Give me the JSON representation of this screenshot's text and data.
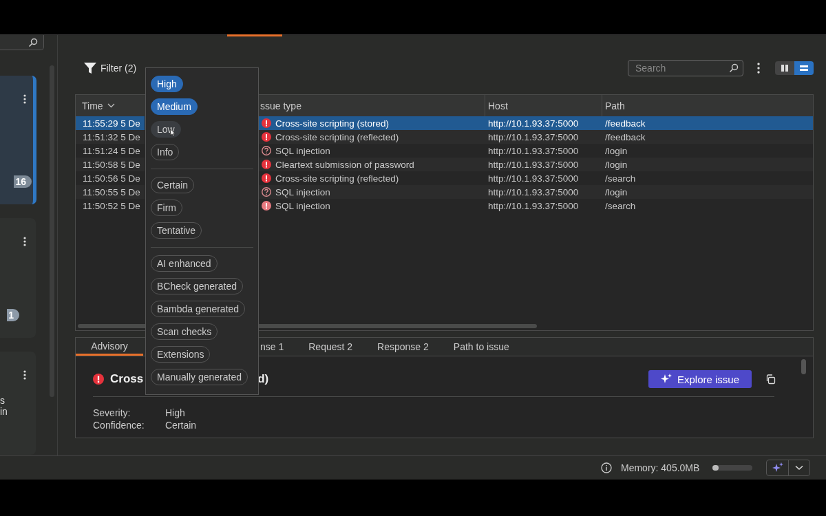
{
  "sidebar": {
    "cards": [
      {
        "selected": true,
        "badge": "16"
      },
      {
        "selected": false,
        "badge": "1"
      },
      {
        "selected": false,
        "text": "s in"
      }
    ]
  },
  "filter": {
    "label": "Filter (2)"
  },
  "filter_menu": {
    "groups": [
      [
        {
          "label": "High",
          "selected": true,
          "hovered": false
        },
        {
          "label": "Medium",
          "selected": true,
          "hovered": false
        },
        {
          "label": "Low",
          "selected": false,
          "hovered": true
        },
        {
          "label": "Info",
          "selected": false,
          "hovered": false
        }
      ],
      [
        {
          "label": "Certain",
          "selected": false,
          "hovered": false
        },
        {
          "label": "Firm",
          "selected": false,
          "hovered": false
        },
        {
          "label": "Tentative",
          "selected": false,
          "hovered": false
        }
      ],
      [
        {
          "label": "AI enhanced",
          "selected": false,
          "hovered": false
        },
        {
          "label": "BCheck generated",
          "selected": false,
          "hovered": false
        },
        {
          "label": "Bambda generated",
          "selected": false,
          "hovered": false
        },
        {
          "label": "Scan checks",
          "selected": false,
          "hovered": false
        },
        {
          "label": "Extensions",
          "selected": false,
          "hovered": false
        },
        {
          "label": "Manually generated",
          "selected": false,
          "hovered": false
        }
      ]
    ]
  },
  "search": {
    "placeholder": "Search"
  },
  "view_toggle": [
    {
      "kind": "columns",
      "selected": false
    },
    {
      "kind": "rows",
      "selected": true
    }
  ],
  "table": {
    "columns": [
      "Time",
      "ssue type",
      "Host",
      "Path"
    ],
    "rows": [
      {
        "time": "11:55:29 5 De",
        "kind": "alert",
        "issue": "Cross-site scripting (stored)",
        "host": "http://10.1.93.37:5000",
        "path": "/feedback",
        "selected": true
      },
      {
        "time": "11:51:32 5 De",
        "kind": "alert",
        "issue": "Cross-site scripting (reflected)",
        "host": "http://10.1.93.37:5000",
        "path": "/feedback",
        "selected": false
      },
      {
        "time": "11:51:24 5 De",
        "kind": "question",
        "issue": "SQL injection",
        "host": "http://10.1.93.37:5000",
        "path": "/login",
        "selected": false
      },
      {
        "time": "11:50:58 5 De",
        "kind": "alert",
        "issue": "Cleartext submission of password",
        "host": "http://10.1.93.37:5000",
        "path": "/login",
        "selected": false
      },
      {
        "time": "11:50:56 5 De",
        "kind": "alert",
        "issue": "Cross-site scripting (reflected)",
        "host": "http://10.1.93.37:5000",
        "path": "/search",
        "selected": false
      },
      {
        "time": "11:50:55 5 De",
        "kind": "question",
        "issue": "SQL injection",
        "host": "http://10.1.93.37:5000",
        "path": "/login",
        "selected": false
      },
      {
        "time": "11:50:52 5 De",
        "kind": "faded",
        "issue": "SQL injection",
        "host": "http://10.1.93.37:5000",
        "path": "/search",
        "selected": false
      }
    ]
  },
  "detail": {
    "tabs": [
      {
        "label": "Advisory",
        "selected": true
      },
      {
        "label": "nse 1",
        "selected": false
      },
      {
        "label": "Request 2",
        "selected": false
      },
      {
        "label": "Response 2",
        "selected": false
      },
      {
        "label": "Path to issue",
        "selected": false
      }
    ],
    "title_parts": [
      "Cross",
      "d)"
    ],
    "explore_button": "Explore issue",
    "fields": [
      {
        "label": "Severity:",
        "value": "High"
      },
      {
        "label": "Confidence:",
        "value": "Certain"
      }
    ]
  },
  "status_bar": {
    "memory": "Memory: 405.0MB",
    "level": 0.15
  }
}
